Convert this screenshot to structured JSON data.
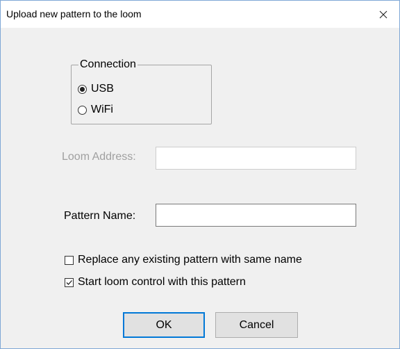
{
  "dialog": {
    "title": "Upload new pattern to the loom"
  },
  "connection": {
    "legend": "Connection",
    "options": [
      {
        "label": "USB",
        "selected": true
      },
      {
        "label": "WiFi",
        "selected": false
      }
    ]
  },
  "loom_address": {
    "label": "Loom Address:",
    "value": "",
    "enabled": false
  },
  "pattern_name": {
    "label": "Pattern Name:",
    "value": ""
  },
  "options": {
    "replace_existing": {
      "label": "Replace any existing pattern with same name",
      "checked": false
    },
    "start_loom_control": {
      "label": "Start loom control with this pattern",
      "checked": true
    }
  },
  "buttons": {
    "ok_label": "OK",
    "cancel_label": "Cancel"
  },
  "colors": {
    "dialog_background": "#f0f0f0",
    "titlebar_background": "#ffffff",
    "window_border": "#7fa7d6",
    "default_button_border": "#0078d7",
    "disabled_text": "#a0a0a0"
  },
  "icons": {
    "close": "close-icon",
    "checkmark": "checkmark-icon"
  }
}
